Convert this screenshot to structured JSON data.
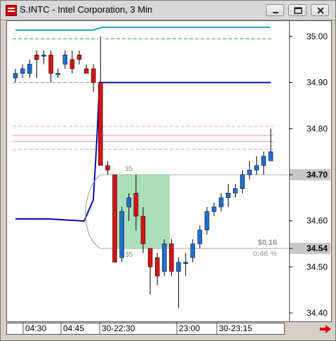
{
  "window": {
    "title": "S.INTC - Intel Corporation, 3 Min"
  },
  "colors": {
    "up": "#1f6fd1",
    "down": "#d41414",
    "box_fill": "#8fd4a4",
    "highlight_bg": "#c8c8c8",
    "teal": "#20a8a8",
    "navy": "#0a0aa8",
    "green_dashed": "#22aa22",
    "pink": "#f090c0",
    "wick": "#000000"
  },
  "price_axis": {
    "labels": [
      "35.00",
      "34.90",
      "34.80",
      "34.70",
      "34.60",
      "34.54",
      "34.50",
      "34.40"
    ],
    "highlighted": [
      "34.70",
      "34.54"
    ]
  },
  "time_axis": {
    "labels": [
      "04:30",
      "04:45",
      "30-22:30",
      "23:00",
      "30-23:15"
    ]
  },
  "annotations": {
    "change_value": "$0.16",
    "change_pct": "0.46 %",
    "box_top_label": "35",
    "box_bottom_label": "35"
  },
  "chart_data": {
    "type": "candlestick",
    "title": "S.INTC - Intel Corporation, 3 Min",
    "ylim": [
      34.38,
      35.06
    ],
    "x_ticks": [
      "04:30",
      "04:45",
      "30-22:30",
      "23:00",
      "30-23:15"
    ],
    "candles": [
      {
        "o": 34.91,
        "h": 34.93,
        "l": 34.9,
        "c": 34.92
      },
      {
        "o": 34.92,
        "h": 34.94,
        "l": 34.91,
        "c": 34.93
      },
      {
        "o": 34.92,
        "h": 34.95,
        "l": 34.91,
        "c": 34.94
      },
      {
        "o": 34.96,
        "h": 34.97,
        "l": 34.91,
        "c": 34.95
      },
      {
        "o": 34.96,
        "h": 34.97,
        "l": 34.94,
        "c": 34.96
      },
      {
        "o": 34.96,
        "h": 34.97,
        "l": 34.9,
        "c": 34.92
      },
      {
        "o": 34.92,
        "h": 34.93,
        "l": 34.91,
        "c": 34.92
      },
      {
        "o": 34.94,
        "h": 34.97,
        "l": 34.93,
        "c": 34.96
      },
      {
        "o": 34.95,
        "h": 34.97,
        "l": 34.92,
        "c": 34.93
      },
      {
        "o": 34.96,
        "h": 34.97,
        "l": 34.94,
        "c": 34.95
      },
      {
        "o": 34.93,
        "h": 34.94,
        "l": 34.92,
        "c": 34.92
      },
      {
        "o": 34.93,
        "h": 34.94,
        "l": 34.88,
        "c": 34.9
      },
      {
        "o": 34.9,
        "h": 35.0,
        "l": 34.72,
        "c": 34.72
      },
      {
        "o": 34.72,
        "h": 34.73,
        "l": 34.7,
        "c": 34.71
      },
      {
        "o": 34.7,
        "h": 34.7,
        "l": 34.51,
        "c": 34.51
      },
      {
        "o": 34.52,
        "h": 34.63,
        "l": 34.51,
        "c": 34.62
      },
      {
        "o": 34.63,
        "h": 34.66,
        "l": 34.6,
        "c": 34.65
      },
      {
        "o": 34.66,
        "h": 34.7,
        "l": 34.58,
        "c": 34.61
      },
      {
        "o": 34.61,
        "h": 34.63,
        "l": 34.53,
        "c": 34.55
      },
      {
        "o": 34.54,
        "h": 34.54,
        "l": 34.44,
        "c": 34.5
      },
      {
        "o": 34.52,
        "h": 34.53,
        "l": 34.46,
        "c": 34.48
      },
      {
        "o": 34.49,
        "h": 34.56,
        "l": 34.48,
        "c": 34.55
      },
      {
        "o": 34.55,
        "h": 34.56,
        "l": 34.48,
        "c": 34.49
      },
      {
        "o": 34.49,
        "h": 34.52,
        "l": 34.41,
        "c": 34.51
      },
      {
        "o": 34.51,
        "h": 34.53,
        "l": 34.48,
        "c": 34.51
      },
      {
        "o": 34.52,
        "h": 34.56,
        "l": 34.51,
        "c": 34.55
      },
      {
        "o": 34.55,
        "h": 34.59,
        "l": 34.54,
        "c": 34.58
      },
      {
        "o": 34.58,
        "h": 34.63,
        "l": 34.57,
        "c": 34.62
      },
      {
        "o": 34.62,
        "h": 34.64,
        "l": 34.61,
        "c": 34.63
      },
      {
        "o": 34.63,
        "h": 34.66,
        "l": 34.62,
        "c": 34.65
      },
      {
        "o": 34.65,
        "h": 34.68,
        "l": 34.63,
        "c": 34.66
      },
      {
        "o": 34.66,
        "h": 34.68,
        "l": 34.65,
        "c": 34.67
      },
      {
        "o": 34.67,
        "h": 34.71,
        "l": 34.66,
        "c": 34.7
      },
      {
        "o": 34.7,
        "h": 34.73,
        "l": 34.69,
        "c": 34.71
      },
      {
        "o": 34.71,
        "h": 34.74,
        "l": 34.7,
        "c": 34.72
      },
      {
        "o": 34.72,
        "h": 34.75,
        "l": 34.7,
        "c": 34.74
      },
      {
        "o": 34.73,
        "h": 34.8,
        "l": 34.73,
        "c": 34.75
      }
    ],
    "horizontal_lines": [
      {
        "name": "teal",
        "y": 35.02
      },
      {
        "name": "green-dashed",
        "y": 34.995
      },
      {
        "name": "grey-dashed",
        "y": 34.9
      },
      {
        "name": "navy",
        "y": 34.9
      },
      {
        "name": "pink-dashed-1",
        "y": 34.805
      },
      {
        "name": "pink-1",
        "y": 34.785
      },
      {
        "name": "pink-2",
        "y": 34.772
      },
      {
        "name": "pink-dashed-2",
        "y": 34.755
      },
      {
        "name": "grey-level-top",
        "y": 34.7
      },
      {
        "name": "grey-level-bottom",
        "y": 34.54
      }
    ]
  }
}
